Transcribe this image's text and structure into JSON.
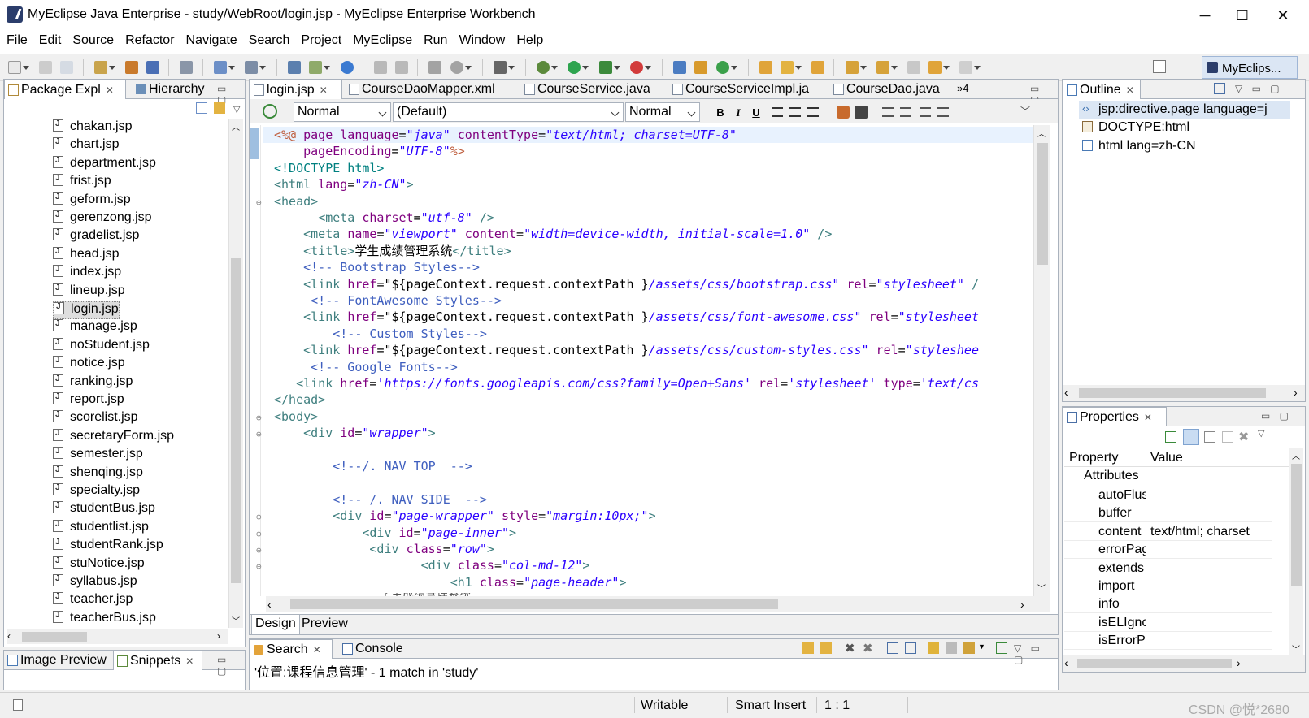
{
  "window": {
    "title": "MyEclipse Java Enterprise - study/WebRoot/login.jsp - MyEclipse Enterprise Workbench",
    "minimize": "─",
    "maximize": "☐",
    "close": "✕"
  },
  "menu": [
    "File",
    "Edit",
    "Source",
    "Refactor",
    "Navigate",
    "Search",
    "Project",
    "MyEclipse",
    "Run",
    "Window",
    "Help"
  ],
  "perspective": "MyEclips...",
  "left_panel": {
    "tabs": [
      "Package Expl",
      "Hierarchy"
    ],
    "files": [
      "chakan.jsp",
      "chart.jsp",
      "department.jsp",
      "frist.jsp",
      "geform.jsp",
      "gerenzong.jsp",
      "gradelist.jsp",
      "head.jsp",
      "index.jsp",
      "lineup.jsp",
      "login.jsp",
      "manage.jsp",
      "noStudent.jsp",
      "notice.jsp",
      "ranking.jsp",
      "report.jsp",
      "scorelist.jsp",
      "secretaryForm.jsp",
      "semester.jsp",
      "shenqing.jsp",
      "specialty.jsp",
      "studentBus.jsp",
      "studentlist.jsp",
      "studentRank.jsp",
      "stuNotice.jsp",
      "syllabus.jsp",
      "teacher.jsp",
      "teacherBus.jsp"
    ],
    "selected_file": "login.jsp"
  },
  "bottom_left_tabs": [
    "Image Preview",
    "Snippets"
  ],
  "editor": {
    "tabs": [
      "login.jsp",
      "CourseDaoMapper.xml",
      "CourseService.java",
      "CourseServiceImpl.ja",
      "CourseDao.java"
    ],
    "overflow": "»4",
    "format_combos": [
      "Normal",
      "(Default)",
      "Normal"
    ],
    "format_buttons": [
      "B",
      "I",
      "U"
    ],
    "bottom_tabs": [
      "Design",
      "Preview"
    ]
  },
  "code_lines": [
    [
      [
        "jd",
        "<%@ "
      ],
      [
        "at",
        "page "
      ],
      [
        "at",
        "language"
      ],
      [
        "",
        "="
      ],
      [
        "st",
        "\"java\""
      ],
      [
        "at",
        " contentType"
      ],
      [
        "",
        "="
      ],
      [
        "st",
        "\"text/html; charset=UTF-8\""
      ]
    ],
    [
      [
        "",
        "    "
      ],
      [
        "at",
        "pageEncoding"
      ],
      [
        "",
        "="
      ],
      [
        "st",
        "\"UTF-8\""
      ],
      [
        "jd",
        "%>"
      ]
    ],
    [
      [
        "dl",
        "<!DOCTYPE html>"
      ]
    ],
    [
      [
        "kw",
        "<html "
      ],
      [
        "at",
        "lang"
      ],
      [
        "",
        "="
      ],
      [
        "st",
        "\"zh-CN\""
      ],
      [
        "kw",
        ">"
      ]
    ],
    [
      [
        "kw",
        "<head>"
      ]
    ],
    [
      [
        "",
        "      "
      ],
      [
        "kw",
        "<meta "
      ],
      [
        "at",
        "charset"
      ],
      [
        "",
        "="
      ],
      [
        "st",
        "\"utf-8\""
      ],
      [
        "kw",
        " />"
      ]
    ],
    [
      [
        "",
        "    "
      ],
      [
        "kw",
        "<meta "
      ],
      [
        "at",
        "name"
      ],
      [
        "",
        "="
      ],
      [
        "st",
        "\"viewport\""
      ],
      [
        "at",
        " content"
      ],
      [
        "",
        "="
      ],
      [
        "st",
        "\"width=device-width, initial-scale=1.0\""
      ],
      [
        "kw",
        " />"
      ]
    ],
    [
      [
        "",
        "    "
      ],
      [
        "kw",
        "<title>"
      ],
      [
        "",
        "学生成绩管理系统"
      ],
      [
        "kw",
        "</title>"
      ]
    ],
    [
      [
        "",
        "    "
      ],
      [
        "cm",
        "<!-- Bootstrap Styles-->"
      ]
    ],
    [
      [
        "",
        "    "
      ],
      [
        "kw",
        "<link "
      ],
      [
        "at",
        "href"
      ],
      [
        "",
        "=\"${pageContext.request.contextPath }"
      ],
      [
        "st",
        "/assets/css/bootstrap.css\""
      ],
      [
        "at",
        " rel"
      ],
      [
        "",
        "="
      ],
      [
        "st",
        "\"stylesheet\""
      ],
      [
        "kw",
        " /"
      ]
    ],
    [
      [
        "",
        "     "
      ],
      [
        "cm",
        "<!-- FontAwesome Styles-->"
      ]
    ],
    [
      [
        "",
        "    "
      ],
      [
        "kw",
        "<link "
      ],
      [
        "at",
        "href"
      ],
      [
        "",
        "=\"${pageContext.request.contextPath }"
      ],
      [
        "st",
        "/assets/css/font-awesome.css\""
      ],
      [
        "at",
        " rel"
      ],
      [
        "",
        "="
      ],
      [
        "st",
        "\"stylesheet"
      ]
    ],
    [
      [
        "",
        "        "
      ],
      [
        "cm",
        "<!-- Custom Styles-->"
      ]
    ],
    [
      [
        "",
        "    "
      ],
      [
        "kw",
        "<link "
      ],
      [
        "at",
        "href"
      ],
      [
        "",
        "=\"${pageContext.request.contextPath }"
      ],
      [
        "st",
        "/assets/css/custom-styles.css\""
      ],
      [
        "at",
        " rel"
      ],
      [
        "",
        "="
      ],
      [
        "st",
        "\"styleshee"
      ]
    ],
    [
      [
        "",
        "     "
      ],
      [
        "cm",
        "<!-- Google Fonts-->"
      ]
    ],
    [
      [
        "",
        "   "
      ],
      [
        "kw",
        "<link "
      ],
      [
        "at",
        "href"
      ],
      [
        "",
        "="
      ],
      [
        "st",
        "'https://fonts.googleapis.com/css?family=Open+Sans'"
      ],
      [
        "at",
        " rel"
      ],
      [
        "",
        "="
      ],
      [
        "st",
        "'stylesheet'"
      ],
      [
        "at",
        " type"
      ],
      [
        "",
        "="
      ],
      [
        "st",
        "'text/cs"
      ]
    ],
    [
      [
        "kw",
        "</head>"
      ]
    ],
    [
      [
        "kw",
        "<body>"
      ]
    ],
    [
      [
        "",
        "    "
      ],
      [
        "kw",
        "<div "
      ],
      [
        "at",
        "id"
      ],
      [
        "",
        "="
      ],
      [
        "st",
        "\"wrapper\""
      ],
      [
        "kw",
        ">"
      ]
    ],
    [
      [
        "",
        ""
      ]
    ],
    [
      [
        "",
        "        "
      ],
      [
        "cm",
        "<!--/. NAV TOP  -->"
      ]
    ],
    [
      [
        "",
        ""
      ]
    ],
    [
      [
        "",
        "        "
      ],
      [
        "cm",
        "<!-- /. NAV SIDE  -->"
      ]
    ],
    [
      [
        "",
        "        "
      ],
      [
        "kw",
        "<div "
      ],
      [
        "at",
        "id"
      ],
      [
        "",
        "="
      ],
      [
        "st",
        "\"page-wrapper\""
      ],
      [
        "at",
        " style"
      ],
      [
        "",
        "="
      ],
      [
        "st",
        "\"margin:10px;\""
      ],
      [
        "kw",
        ">"
      ]
    ],
    [
      [
        "",
        "            "
      ],
      [
        "kw",
        "<div "
      ],
      [
        "at",
        "id"
      ],
      [
        "",
        "="
      ],
      [
        "st",
        "\"page-inner\""
      ],
      [
        "kw",
        ">"
      ]
    ],
    [
      [
        "",
        "             "
      ],
      [
        "kw",
        "<div "
      ],
      [
        "at",
        "class"
      ],
      [
        "",
        "="
      ],
      [
        "st",
        "\"row\""
      ],
      [
        "kw",
        ">"
      ]
    ],
    [
      [
        "",
        "                    "
      ],
      [
        "kw",
        "<div "
      ],
      [
        "at",
        "class"
      ],
      [
        "",
        "="
      ],
      [
        "st",
        "\"col-md-12\""
      ],
      [
        "kw",
        ">"
      ]
    ],
    [
      [
        "",
        "                        "
      ],
      [
        "kw",
        "<h1 "
      ],
      [
        "at",
        "class"
      ],
      [
        "",
        "="
      ],
      [
        "st",
        "\"page-header\""
      ],
      [
        "kw",
        ">"
      ]
    ]
  ],
  "outline": {
    "tab": "Outline",
    "items": [
      "jsp:directive.page language=j",
      "DOCTYPE:html",
      "html lang=zh-CN"
    ]
  },
  "properties": {
    "tab": "Properties",
    "col_property": "Property",
    "col_value": "Value",
    "group": "Attributes",
    "rows": [
      [
        "autoFlus",
        ""
      ],
      [
        "buffer",
        ""
      ],
      [
        "content",
        "text/html; charset"
      ],
      [
        "errorPag",
        ""
      ],
      [
        "extends",
        ""
      ],
      [
        "import",
        ""
      ],
      [
        "info",
        ""
      ],
      [
        "isELIgno",
        ""
      ],
      [
        "isErrorPa",
        ""
      ]
    ]
  },
  "bottom_panel": {
    "tabs": [
      "Search",
      "Console"
    ],
    "result": "'位置:课程信息管理' - 1 match in 'study'"
  },
  "status": {
    "writable": "Writable",
    "insert": "Smart Insert",
    "position": "1 : 1",
    "watermark": "CSDN @悦*2680"
  }
}
